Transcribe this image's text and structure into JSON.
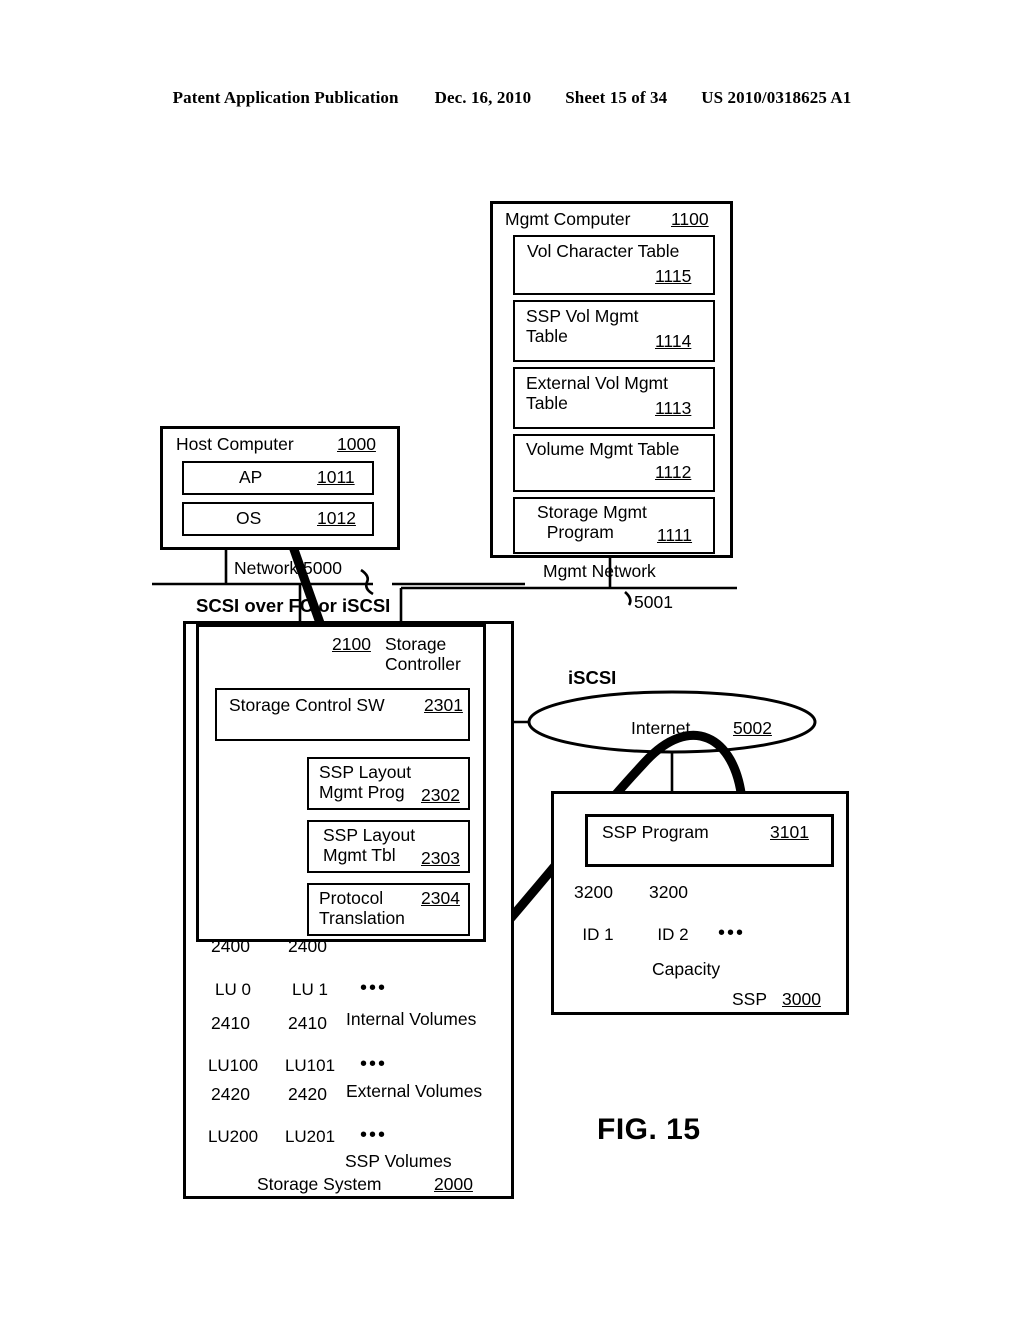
{
  "header": {
    "publication": "Patent Application Publication",
    "date": "Dec. 16, 2010",
    "sheet": "Sheet 15 of 34",
    "patent_number": "US 2010/0318625 A1"
  },
  "figure": {
    "label": "FIG. 15"
  },
  "mgmt_computer": {
    "title": "Mgmt Computer",
    "ref": "1100",
    "items": [
      {
        "label": "Vol Character Table",
        "ref": "1115"
      },
      {
        "label": "SSP Vol Mgmt\nTable",
        "ref": "1114"
      },
      {
        "label": "External Vol Mgmt\nTable",
        "ref": "1113"
      },
      {
        "label": "Volume Mgmt Table",
        "ref": "1112"
      },
      {
        "label": "Storage Mgmt\n  Program",
        "ref": "1111"
      }
    ]
  },
  "host_computer": {
    "title": "Host Computer",
    "ref": "1000",
    "items": [
      {
        "label": "AP",
        "ref": "1011"
      },
      {
        "label": "OS",
        "ref": "1012"
      }
    ]
  },
  "networks": {
    "network": {
      "label": "Network 5000"
    },
    "network_protocol": {
      "label": "SCSI over FC or iSCSI"
    },
    "mgmt_network": {
      "label": "Mgmt Network",
      "ref": "5001"
    },
    "internet": {
      "label": "Internet",
      "ref": "5002"
    },
    "iscsi": {
      "label": "iSCSI"
    }
  },
  "storage_system": {
    "title": "Storage System",
    "ref": "2000",
    "controller": {
      "title": "Storage\nController",
      "ref": "2100"
    },
    "modules": [
      {
        "label": "Storage Control SW",
        "ref": "2301"
      },
      {
        "label": "SSP Layout\nMgmt Prog",
        "ref": "2302"
      },
      {
        "label": "SSP Layout\nMgmt Tbl",
        "ref": "2303"
      },
      {
        "label": "Protocol\nTranslation",
        "ref": "2304"
      }
    ],
    "volume_groups": [
      {
        "group_label": "Internal Volumes",
        "ref": "2400",
        "volumes": [
          "LU 0",
          "LU 1"
        ],
        "ellipsis": "•••"
      },
      {
        "group_label": "External Volumes",
        "ref": "2410",
        "volumes": [
          "LU100",
          "LU101"
        ],
        "ellipsis": "•••"
      },
      {
        "group_label": "SSP Volumes",
        "ref": "2420",
        "volumes": [
          "LU200",
          "LU201"
        ],
        "ellipsis": "•••"
      }
    ]
  },
  "ssp": {
    "title": "SSP",
    "ref": "3000",
    "program": {
      "label": "SSP Program",
      "ref": "3101"
    },
    "capacity_label": "Capacity",
    "capacity_ref": "3200",
    "capacities": [
      "ID 1",
      "ID 2"
    ],
    "ellipsis": "•••"
  },
  "colors": {
    "ink": "#000000",
    "paper": "#ffffff"
  }
}
